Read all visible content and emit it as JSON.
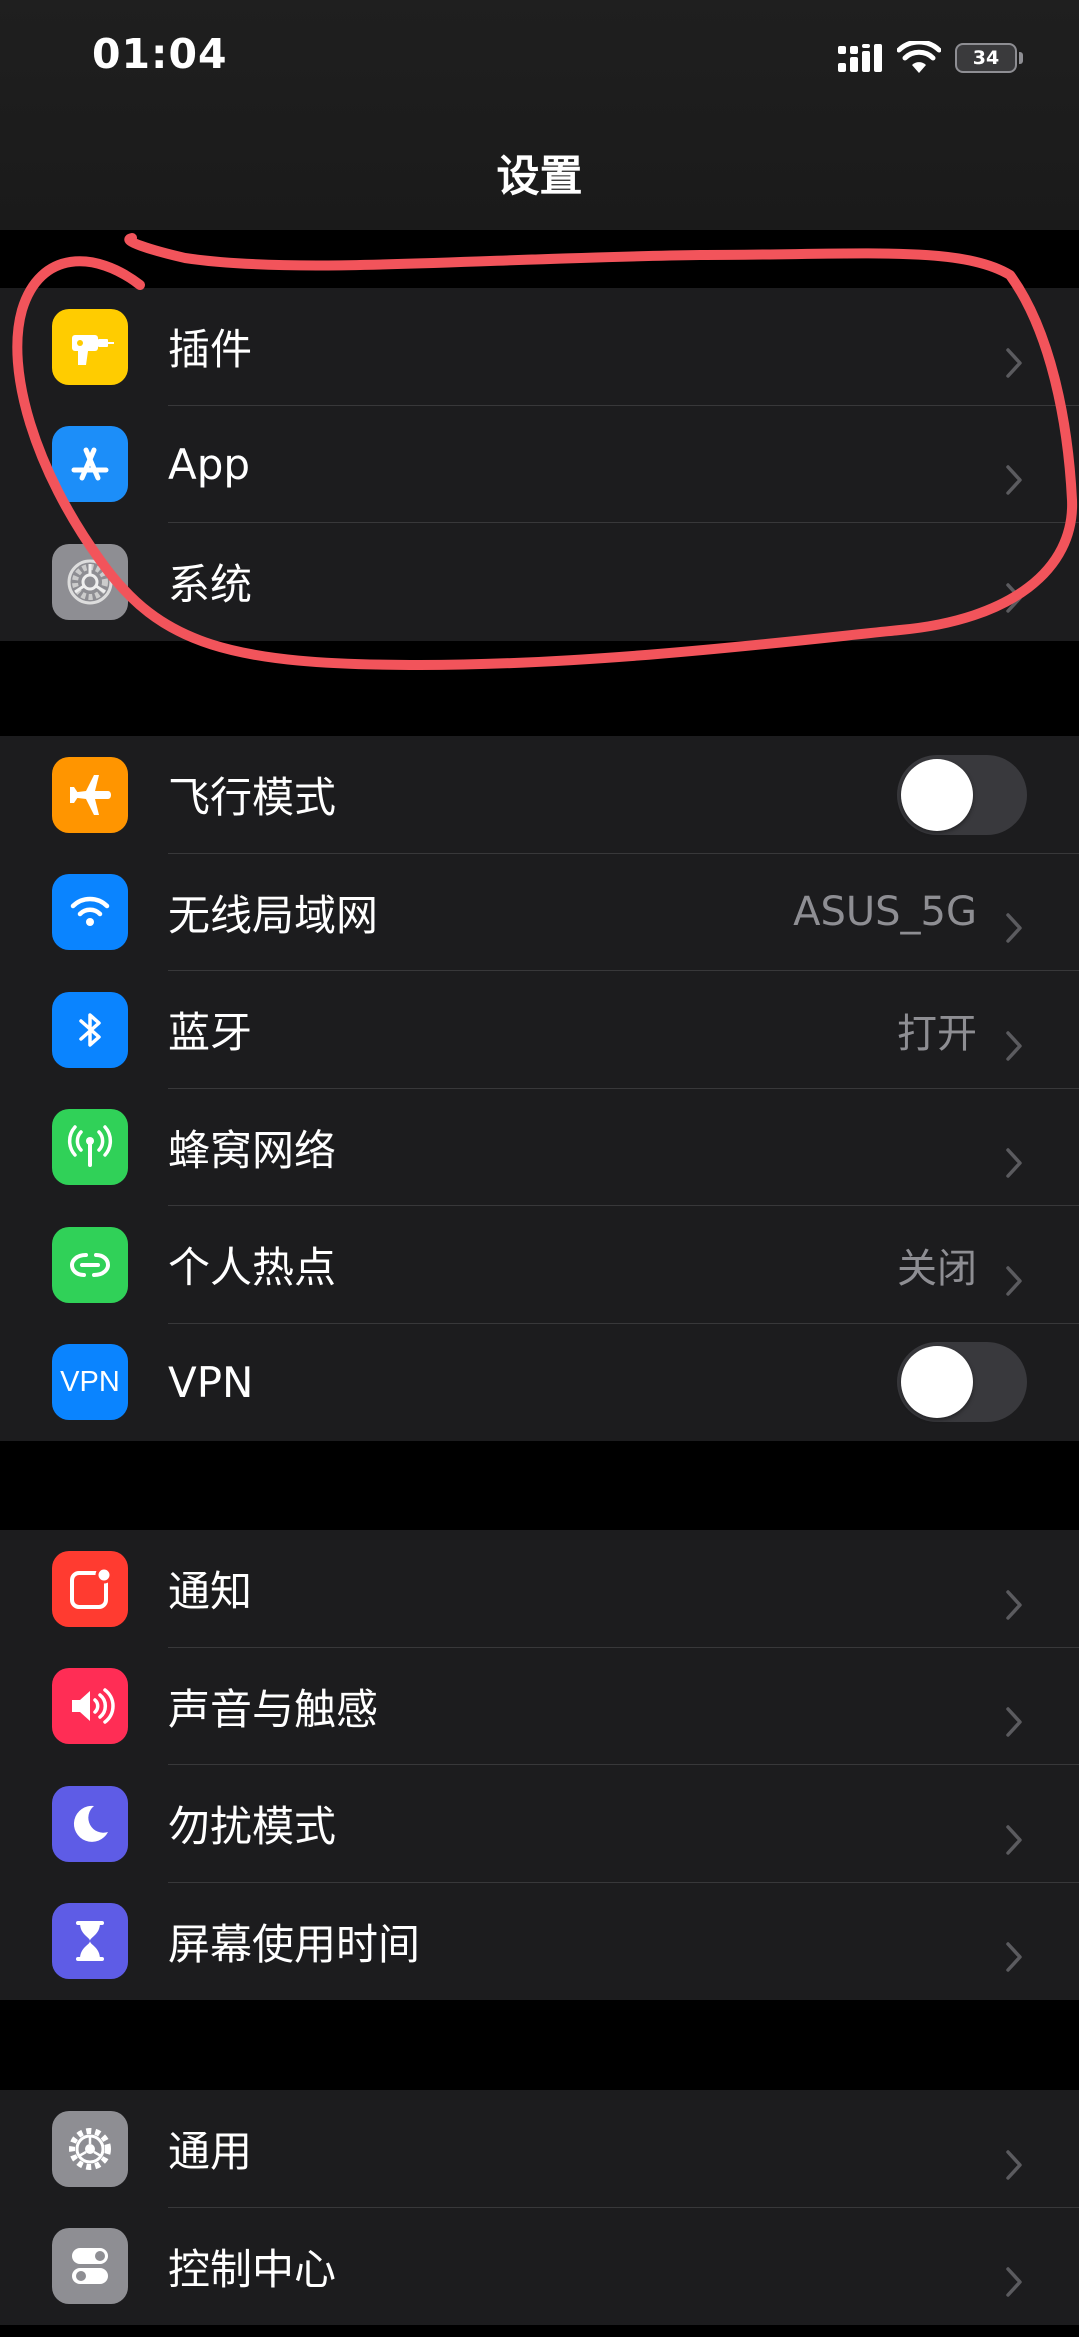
{
  "status": {
    "time": "01:04",
    "battery": "34"
  },
  "nav": {
    "title": "设置"
  },
  "groups": [
    {
      "rows": [
        {
          "label": "插件",
          "icon": "drill-icon",
          "color": "#FFCC00"
        },
        {
          "label": "App",
          "icon": "app-store-icon",
          "color": "#1C8EF9"
        },
        {
          "label": "系统",
          "icon": "gear-icon",
          "color": "#8E8E93"
        }
      ]
    },
    {
      "rows": [
        {
          "label": "飞行模式",
          "icon": "airplane-icon",
          "color": "#FF9500",
          "toggle": false
        },
        {
          "label": "无线局域网",
          "icon": "wifi-icon",
          "color": "#0A84FF",
          "value": "ASUS_5G"
        },
        {
          "label": "蓝牙",
          "icon": "bluetooth-icon",
          "color": "#0A84FF",
          "value": "打开"
        },
        {
          "label": "蜂窝网络",
          "icon": "cellular-icon",
          "color": "#30D158"
        },
        {
          "label": "个人热点",
          "icon": "hotspot-icon",
          "color": "#30D158",
          "value": "关闭"
        },
        {
          "label": "VPN",
          "icon": "vpn-icon",
          "icon_text": "VPN",
          "color": "#0A84FF",
          "toggle": false
        }
      ]
    },
    {
      "rows": [
        {
          "label": "通知",
          "icon": "notification-icon",
          "color": "#FF3B30"
        },
        {
          "label": "声音与触感",
          "icon": "speaker-icon",
          "color": "#FF2D55"
        },
        {
          "label": "勿扰模式",
          "icon": "moon-icon",
          "color": "#5E5CE6"
        },
        {
          "label": "屏幕使用时间",
          "icon": "hourglass-icon",
          "color": "#5E5CE6"
        }
      ]
    },
    {
      "rows": [
        {
          "label": "通用",
          "icon": "settings-gear-icon",
          "color": "#8E8E93"
        },
        {
          "label": "控制中心",
          "icon": "switches-icon",
          "color": "#8E8E93"
        }
      ]
    }
  ],
  "annotation": {
    "color": "#F2545B"
  }
}
